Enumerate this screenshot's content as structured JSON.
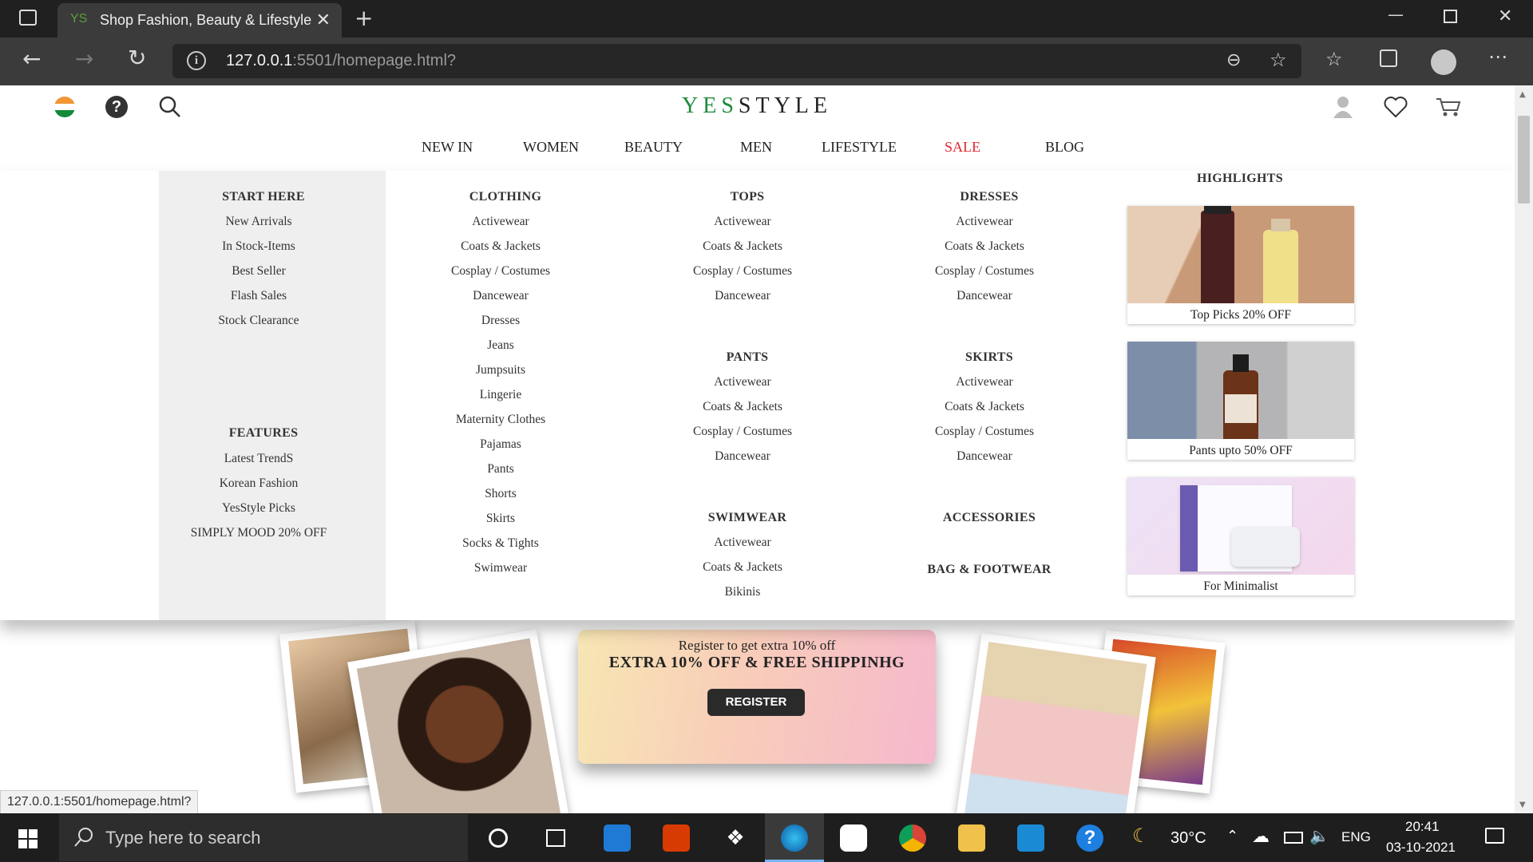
{
  "browser": {
    "tab_title": "Shop Fashion, Beauty & Lifestyle",
    "tab_favicon": "YS",
    "url_host": "127.0.0.1",
    "url_rest": ":5501/homepage.html?",
    "status_url": "127.0.0.1:5501/homepage.html?"
  },
  "header": {
    "logo_prefix": "YES",
    "logo_suffix": "STYLE",
    "nav": [
      "NEW IN",
      "WOMEN",
      "BEAUTY",
      "MEN",
      "LIFESTYLE",
      "SALE",
      "BLOG"
    ]
  },
  "menu": {
    "start_here": {
      "heading": "START HERE",
      "items": [
        "New Arrivals",
        "In Stock-Items",
        "Best Seller",
        "Flash Sales",
        "Stock Clearance"
      ]
    },
    "features": {
      "heading": "FEATURES",
      "items": [
        "Latest TrendS",
        "Korean Fashion",
        "YesStyle Picks",
        "SIMPLY MOOD 20% OFF"
      ]
    },
    "clothing": {
      "heading": "CLOTHING",
      "items": [
        "Activewear",
        "Coats & Jackets",
        "Cosplay / Costumes",
        "Dancewear",
        "Dresses",
        "Jeans",
        "Jumpsuits",
        "Lingerie",
        "Maternity Clothes",
        "Pajamas",
        "Pants",
        "Shorts",
        "Skirts",
        "Socks & Tights",
        "Swimwear"
      ]
    },
    "tops": {
      "heading": "TOPS",
      "items": [
        "Activewear",
        "Coats & Jackets",
        "Cosplay / Costumes",
        "Dancewear"
      ]
    },
    "pants": {
      "heading": "PANTS",
      "items": [
        "Activewear",
        "Coats & Jackets",
        "Cosplay / Costumes",
        "Dancewear"
      ]
    },
    "swimwear": {
      "heading": "SWIMWEAR",
      "items": [
        "Activewear",
        "Coats & Jackets",
        "Bikinis"
      ]
    },
    "dresses": {
      "heading": "DRESSES",
      "items": [
        "Activewear",
        "Coats & Jackets",
        "Cosplay / Costumes",
        "Dancewear"
      ]
    },
    "skirts": {
      "heading": "SKIRTS",
      "items": [
        "Activewear",
        "Coats & Jackets",
        "Cosplay / Costumes",
        "Dancewear"
      ]
    },
    "accessories": {
      "heading": "ACCESSORIES"
    },
    "bag_footwear": {
      "heading": "BAG & FOOTWEAR"
    },
    "highlights": {
      "heading": "HIGHLIGHTS",
      "cards": [
        "Top Picks 20% OFF",
        "Pants upto 50% OFF",
        "For Minimalist"
      ]
    }
  },
  "register": {
    "line1": "Register to get extra 10% off",
    "line2": "EXTRA 10% OFF & FREE SHIPPINHG",
    "button": "REGISTER"
  },
  "taskbar": {
    "search_placeholder": "Type here to search",
    "temperature": "30°C",
    "language": "ENG",
    "time": "20:41",
    "date": "03-10-2021"
  },
  "colors": {
    "sale": "#e0262f",
    "logo_green": "#1f8a3a",
    "panel": "#efefef"
  }
}
